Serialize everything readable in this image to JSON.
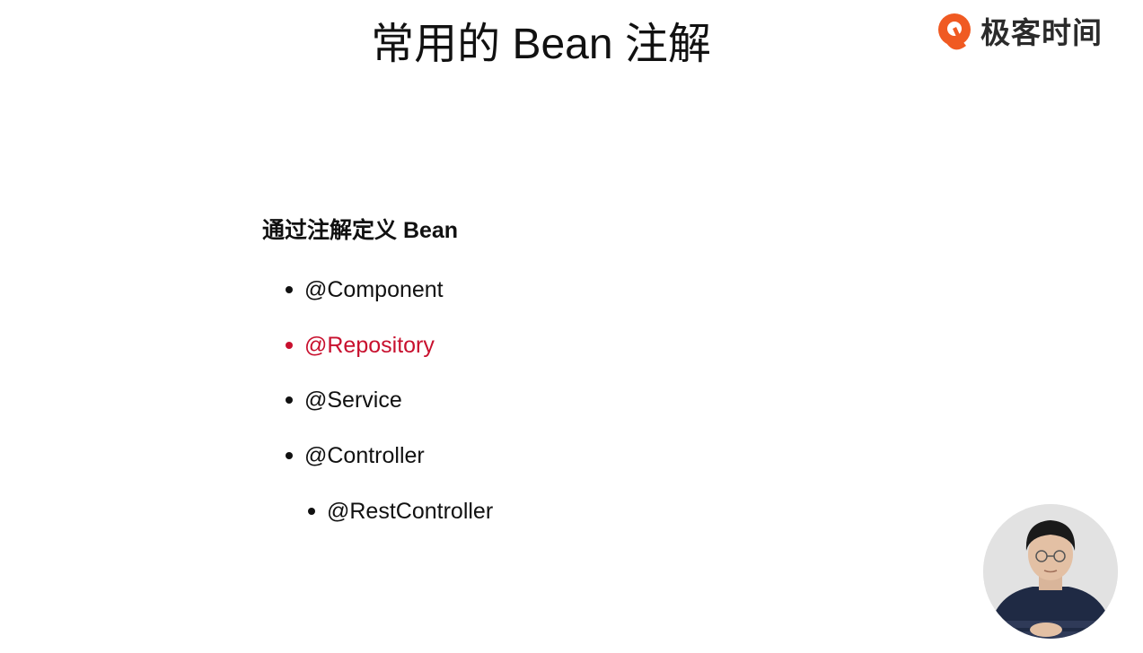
{
  "slide": {
    "title": "常用的 Bean 注解"
  },
  "logo": {
    "text": "极客时间",
    "icon": "geektime-logo-icon",
    "color": "#f05a22"
  },
  "section": {
    "heading": "通过注解定义 Bean",
    "items": [
      {
        "label": "@Component",
        "level": 1,
        "color": "#111111"
      },
      {
        "label": "@Repository",
        "level": 1,
        "color": "#c8102e"
      },
      {
        "label": "@Service",
        "level": 1,
        "color": "#111111"
      },
      {
        "label": "@Controller",
        "level": 1,
        "color": "#111111"
      },
      {
        "label": "@RestController",
        "level": 2,
        "color": "#111111"
      }
    ]
  },
  "presenter": {
    "icon": "presenter-webcam"
  }
}
